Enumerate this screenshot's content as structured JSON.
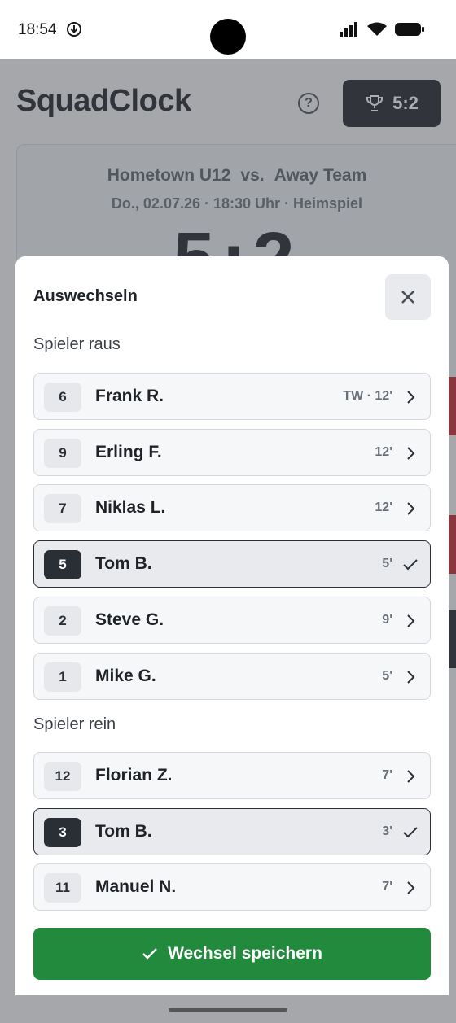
{
  "status_bar": {
    "time": "18:54"
  },
  "app": {
    "title": "SquadClock",
    "score_button": "5:2",
    "match": {
      "home_team": "Hometown U12",
      "vs": "vs.",
      "away_team": "Away Team",
      "info": "Do., 02.07.26 · 18:30 Uhr · Heimspiel",
      "score": "5:2"
    }
  },
  "sheet": {
    "title": "Auswechseln",
    "out_label": "Spieler raus",
    "in_label": "Spieler rein",
    "out_players": [
      {
        "number": "6",
        "name": "Frank R.",
        "meta": "TW · 12'",
        "selected": false
      },
      {
        "number": "9",
        "name": "Erling F.",
        "meta": "12'",
        "selected": false
      },
      {
        "number": "7",
        "name": "Niklas L.",
        "meta": "12'",
        "selected": false
      },
      {
        "number": "5",
        "name": "Tom B.",
        "meta": "5'",
        "selected": true
      },
      {
        "number": "2",
        "name": "Steve G.",
        "meta": "9'",
        "selected": false
      },
      {
        "number": "1",
        "name": "Mike G.",
        "meta": "5'",
        "selected": false
      }
    ],
    "in_players": [
      {
        "number": "12",
        "name": "Florian Z.",
        "meta": "7'",
        "selected": false
      },
      {
        "number": "3",
        "name": "Tom B.",
        "meta": "3'",
        "selected": true
      },
      {
        "number": "11",
        "name": "Manuel N.",
        "meta": "7'",
        "selected": false
      }
    ],
    "save_label": "Wechsel speichern"
  },
  "colors": {
    "accent_green": "#218a3c",
    "dark": "#1f2328",
    "red": "#c0262d"
  }
}
